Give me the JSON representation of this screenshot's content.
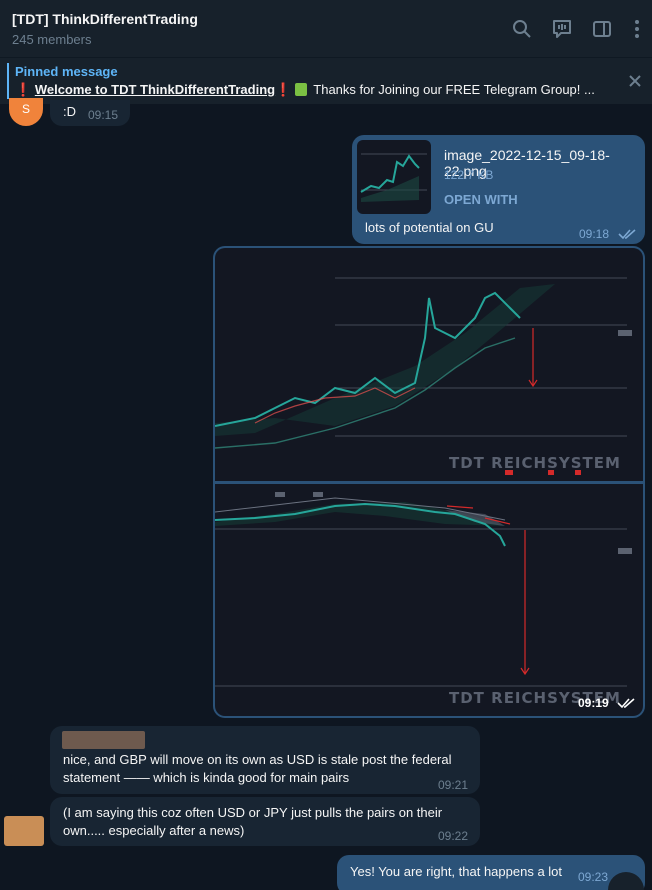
{
  "header": {
    "title": "[TDT] ThinkDifferentTrading",
    "members": "245 members",
    "icons": [
      "search-icon",
      "voice-chat-icon",
      "sidebar-toggle-icon",
      "more-vertical-icon"
    ]
  },
  "pinned": {
    "label": "Pinned message",
    "excl": "❗",
    "link_text": "Welcome to TDT ThinkDifferentTrading",
    "rest_text": " Thanks for Joining  our FREE Telegram Group! ..."
  },
  "messages": {
    "m1": {
      "avatar_letter": "S",
      "text": ":D",
      "time": "09:15"
    },
    "m2": {
      "file_name": "image_2022-12-15_09-18-22.png",
      "file_size": "122.7 KB",
      "open_with": "OPEN WITH",
      "caption": "lots of potential on GU",
      "time": "09:18"
    },
    "m3": {
      "watermark_top": "TDT REICHSYSTEM",
      "watermark_bottom": "TDT REICHSYSTEM",
      "time": "09:19"
    },
    "m4": {
      "text_line1": "nice, and GBP will move on  its own as USD is stale post the federal",
      "text_line2": "statement —— which is kinda good for main pairs",
      "time": "09:21"
    },
    "m5": {
      "text_line1": "(I am saying this coz often USD or JPY just pulls the pairs on their",
      "text_line2": "own..... especially after a news)",
      "time": "09:22"
    },
    "m6": {
      "text": "Yes! You are right, that happens a lot",
      "time": "09:23"
    }
  },
  "colors": {
    "bg": "#0e1621",
    "header": "#17212b",
    "bubble_in": "#182533",
    "bubble_out": "#2b5278",
    "accent": "#5eb5f7",
    "candle_up": "#26a69a",
    "candle_down": "#ef5350"
  }
}
